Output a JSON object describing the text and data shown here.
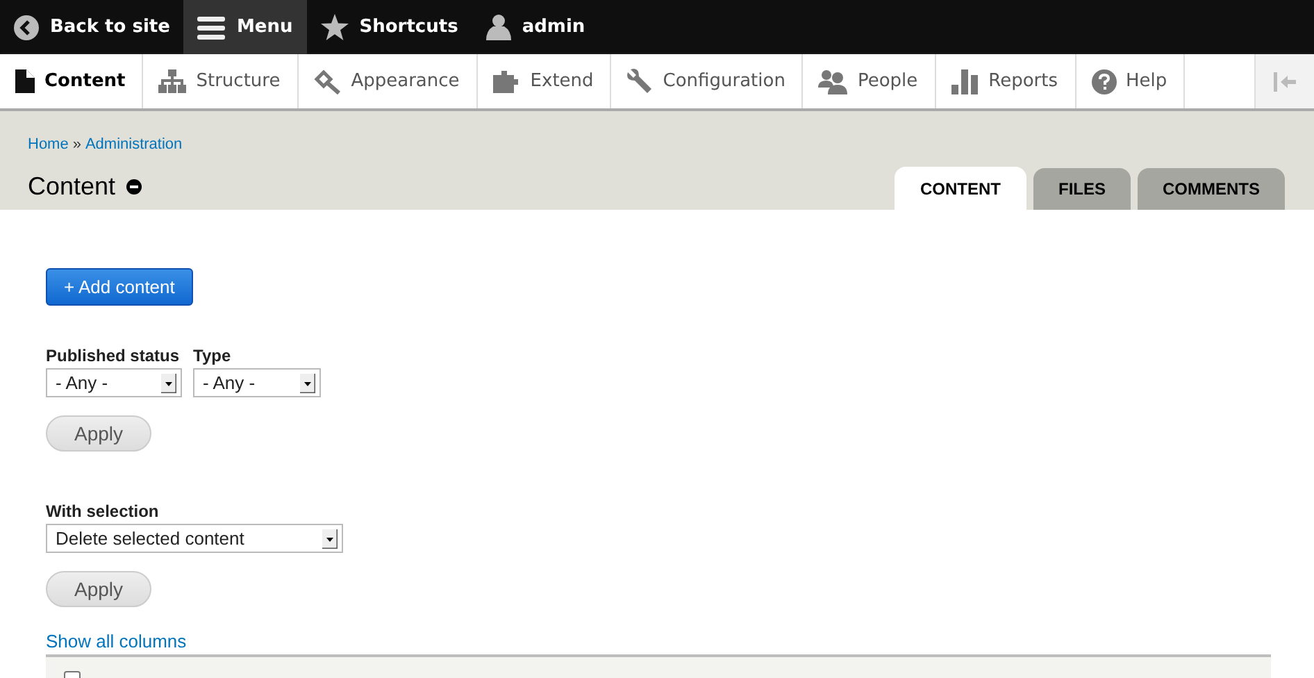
{
  "toolbar": {
    "items": [
      {
        "label": "Back to site",
        "selected": false
      },
      {
        "label": "Menu",
        "selected": true
      },
      {
        "label": "Shortcuts",
        "selected": false
      },
      {
        "label": "admin",
        "selected": false
      }
    ]
  },
  "tray": {
    "items": [
      {
        "label": "Content",
        "selected": true
      },
      {
        "label": "Structure",
        "selected": false
      },
      {
        "label": "Appearance",
        "selected": false
      },
      {
        "label": "Extend",
        "selected": false
      },
      {
        "label": "Configuration",
        "selected": false
      },
      {
        "label": "People",
        "selected": false
      },
      {
        "label": "Reports",
        "selected": false
      },
      {
        "label": "Help",
        "selected": false
      }
    ]
  },
  "breadcrumb": [
    "Home",
    "»",
    "Administration"
  ],
  "page_title": "Content",
  "tabs": [
    {
      "label": "CONTENT",
      "selected": true
    },
    {
      "label": "FILES",
      "selected": false
    },
    {
      "label": "COMMENTS",
      "selected": false
    }
  ],
  "add_button": "+ Add content",
  "filters": [
    {
      "label": "Published status",
      "value": "- Any -"
    },
    {
      "label": "Type",
      "value": "- Any -"
    }
  ],
  "filter_apply": "Apply",
  "bulk": {
    "label": "With selection",
    "value": "Delete selected content",
    "apply": "Apply"
  },
  "show_all_columns": "Show all columns",
  "table": {
    "select_all": {
      "checked": false
    }
  }
}
